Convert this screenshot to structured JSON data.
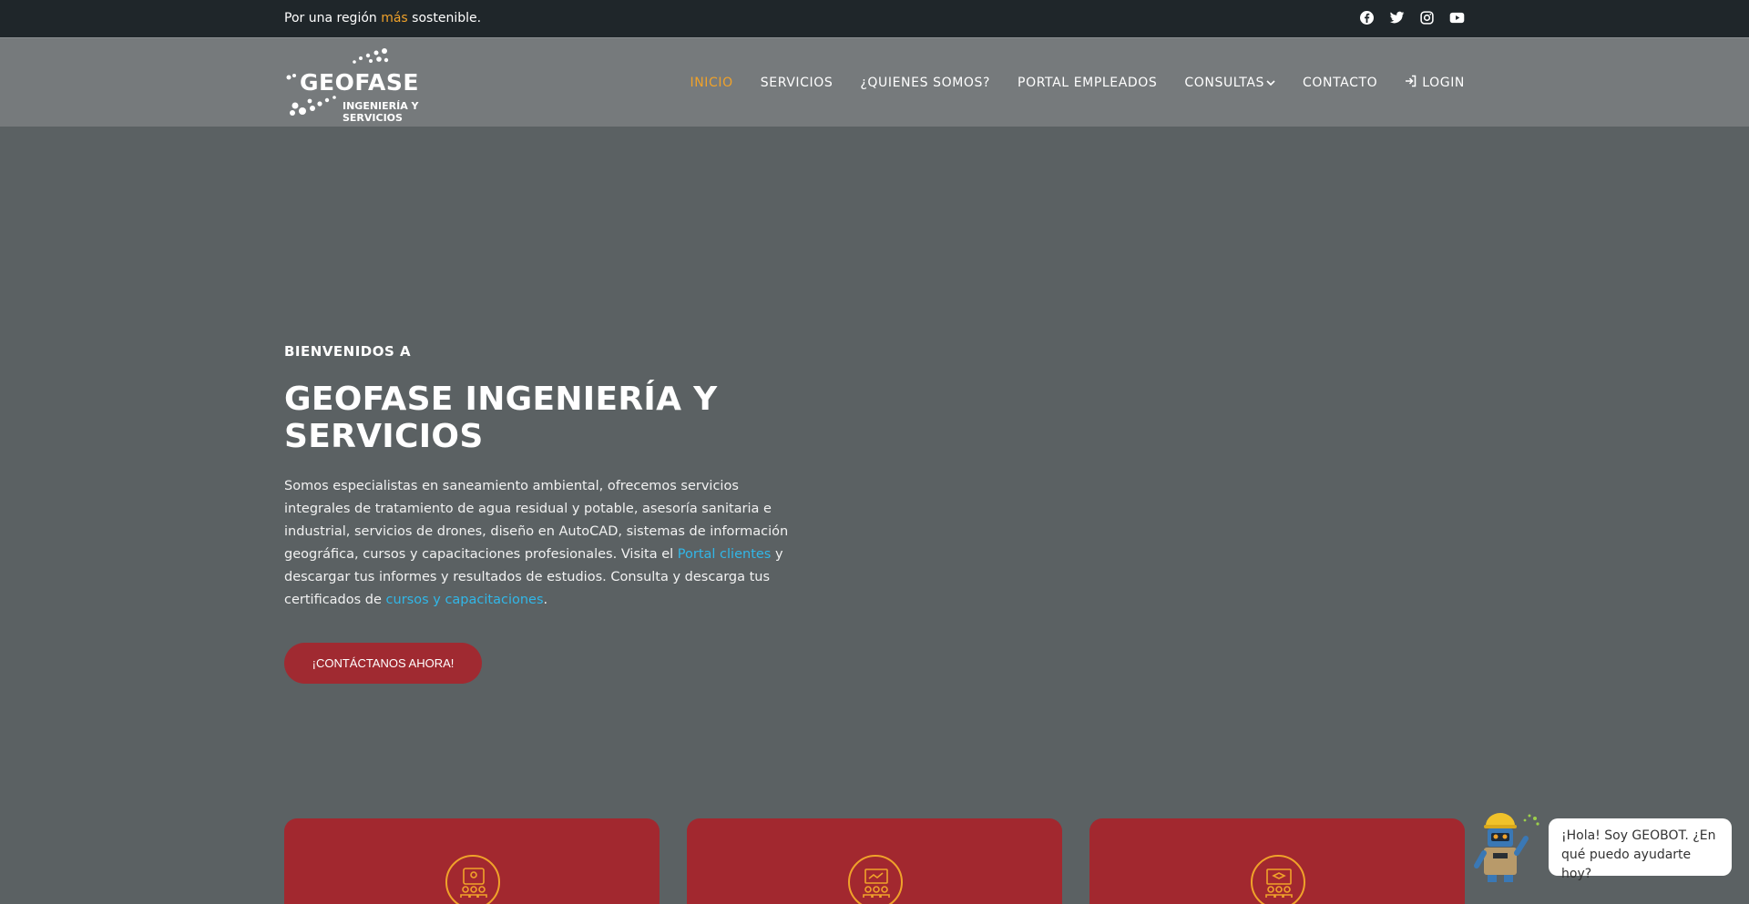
{
  "topbar": {
    "tagline_pre": "Por una región ",
    "tagline_highlight": "más",
    "tagline_post": " sostenible.",
    "social": [
      "facebook-icon",
      "twitter-icon",
      "instagram-icon",
      "youtube-icon"
    ]
  },
  "logo": {
    "word": "GEOFASE",
    "sub": "INGENIERÍA Y SERVICIOS"
  },
  "nav": {
    "items": [
      {
        "label": "INICIO",
        "active": true
      },
      {
        "label": "SERVICIOS"
      },
      {
        "label": "¿QUIENES SOMOS?"
      },
      {
        "label": "PORTAL EMPLEADOS"
      },
      {
        "label": "CONSULTAS"
      },
      {
        "label": "CONTACTO"
      },
      {
        "label": "LOGIN"
      }
    ]
  },
  "hero": {
    "eyebrow": "BIENVENIDOS A",
    "title": "GEOFASE INGENIERÍA Y SERVICIOS",
    "desc_1": "Somos especialistas en saneamiento ambiental, ofrecemos servicios integrales de tratamiento de agua residual y potable, asesoría sanitaria e industrial, servicios de drones, diseño en AutoCAD, sistemas de información geográfica, cursos y capacitaciones profesionales. Visita el ",
    "link_1": "Portal clientes",
    "desc_2": " y descargar tus informes y resultados de estudios. Consulta y descarga tus certificados de ",
    "link_2": "cursos y capacitaciones",
    "desc_3": ".",
    "cta": "¡CONTÁCTANOS AHORA!"
  },
  "chat": {
    "message": "¡Hola! Soy GEOBOT. ¿En qué puedo ayudarte hoy?"
  },
  "colors": {
    "accent": "#f0a22a",
    "brand_red": "#a2282f",
    "link": "#31b7e8"
  }
}
